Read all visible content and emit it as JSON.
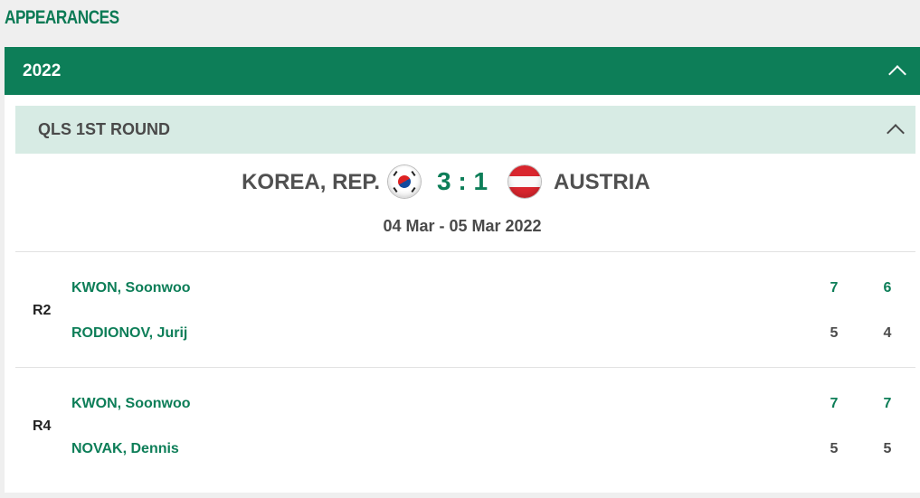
{
  "section_title": "APPEARANCES",
  "year": {
    "label": "2022"
  },
  "round": {
    "label": "QLS 1ST ROUND"
  },
  "tie": {
    "home": "KOREA, REP.",
    "away": "AUSTRIA",
    "score": "3 : 1",
    "dates": "04 Mar - 05 Mar 2022",
    "home_flag_icon": "korea-flag-icon",
    "away_flag_icon": "austria-flag-icon"
  },
  "matches": [
    {
      "rubber": "R2",
      "player1": "KWON, Soonwoo",
      "player2": "RODIONOV, Jurij",
      "p1_sets": [
        "7",
        "6"
      ],
      "p2_sets": [
        "5",
        "4"
      ]
    },
    {
      "rubber": "R4",
      "player1": "KWON, Soonwoo",
      "player2": "NOVAK, Dennis",
      "p1_sets": [
        "7",
        "7"
      ],
      "p2_sets": [
        "5",
        "5"
      ]
    }
  ],
  "colors": {
    "accent": "#0d7e58",
    "round_bg": "#d7ebe4",
    "page_bg": "#efefef"
  }
}
